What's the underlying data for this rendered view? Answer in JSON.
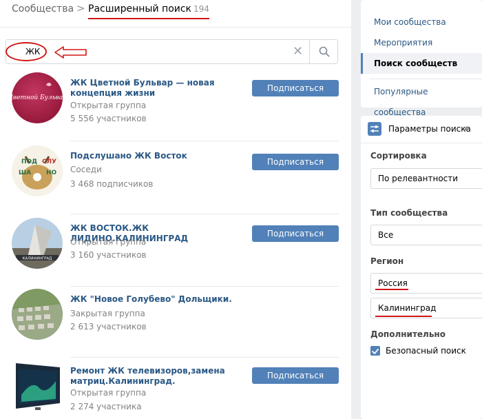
{
  "breadcrumb": {
    "communities": "Сообщества",
    "separator": ">",
    "current": "Расширенный поиск",
    "count": "194"
  },
  "search": {
    "value": "ЖК"
  },
  "results": [
    {
      "name": "ЖК Цветной Бульвар — новая концепция жизни",
      "type": "Открытая группа",
      "members": "5 556 участников",
      "button": "Подписаться"
    },
    {
      "name": "Подслушано ЖК Восток",
      "type": "Соседи",
      "members": "3 468 подписчиков",
      "button": "Подписаться"
    },
    {
      "name": "ЖК ВОСТОК.ЖК ЛИДИНО.КАЛИНИНГРАД",
      "type": "Открытая группа",
      "members": "3 160 участников",
      "button": "Подписаться"
    },
    {
      "name": "ЖК \"Новое Голубево\" Дольщики.",
      "type": "Закрытая группа",
      "members": "2 613 участников",
      "button": "Подписаться"
    },
    {
      "name": "Ремонт ЖК телевизоров,замена матриц.Калининград.",
      "type": "Открытая группа",
      "members": "2 274 участника",
      "button": "Подписаться"
    }
  ],
  "avatar_texts": {
    "first": "Цветной Бульвар",
    "second": [
      "ПОД",
      "СЛУ",
      "ША",
      "НО"
    ],
    "third": "КАЛИНИНГРАД"
  },
  "nav": {
    "my": "Мои сообщества",
    "events": "Мероприятия",
    "search": "Поиск сообществ",
    "popular": "Популярные сообщества"
  },
  "params": {
    "title": "Параметры поиска",
    "sort_label": "Сортировка",
    "sort_value": "По релевантности",
    "type_label": "Тип сообщества",
    "type_value": "Все",
    "region_label": "Регион",
    "country_value": "Россия",
    "city_value": "Калининград",
    "extra_label": "Дополнительно",
    "safe_search": "Безопасный поиск"
  },
  "colors": {
    "accent": "#5181b8",
    "link": "#2a5885",
    "annotation": "#d11515"
  }
}
